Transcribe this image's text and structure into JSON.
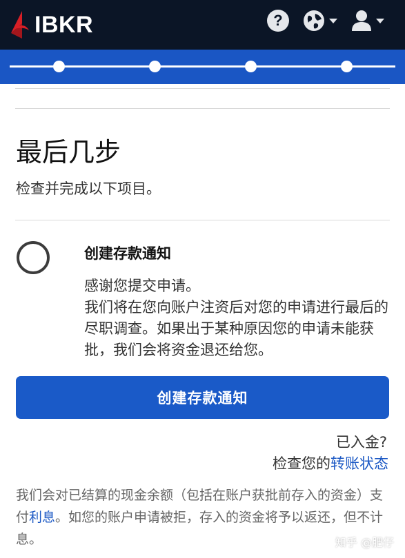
{
  "header": {
    "logo_text": "IBKR",
    "help_label": "?",
    "icons": [
      "ibkr-logo-icon",
      "help-icon",
      "globe-icon",
      "user-icon",
      "chevron-down-icon"
    ]
  },
  "progress": {
    "total_steps": 4,
    "completed_steps": 4
  },
  "main": {
    "title": "最后几步",
    "subtitle": "检查并完成以下项目。",
    "task": {
      "title": "创建存款通知",
      "description": "感谢您提交申请。\n我们将在您向账户注资后对您的申请进行最后的尽职调查。如果出于某种原因您的申请未能获批，我们会将资金退还给您。",
      "button_label": "创建存款通知",
      "done": false
    },
    "funded_question": "已入金?",
    "check_prefix": "检查您的",
    "check_link": "转账状态",
    "note_prefix": "我们会对已结算的现金余额（包括在账户获批前存入的资金）支付",
    "note_link": "利息",
    "note_suffix": "。如您的账户申请被拒，存入的资金将予以返还，但不计息。"
  },
  "watermark": "知乎 @肥仔",
  "colors": {
    "topbar": "#0b1526",
    "progress": "#1a56c4",
    "button": "#1a5ac8",
    "link": "#1b58c4",
    "logo_red": "#d81f26"
  }
}
